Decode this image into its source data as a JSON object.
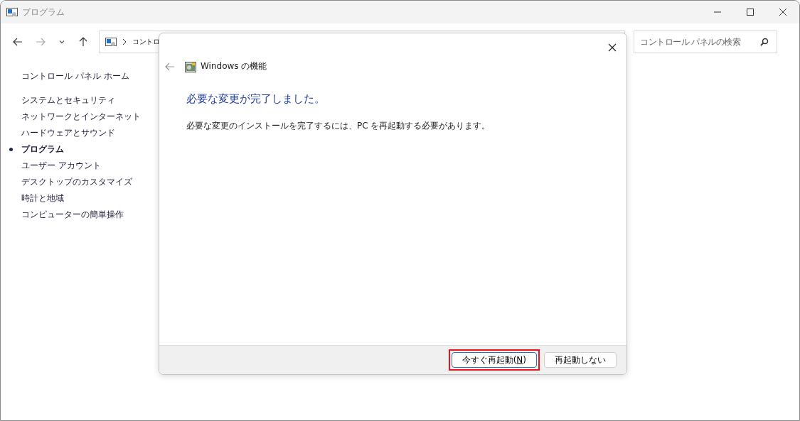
{
  "window": {
    "title": "プログラム"
  },
  "address_bar": {
    "crumb": "コントロ"
  },
  "search": {
    "placeholder": "コントロール パネルの検索"
  },
  "sidebar": {
    "home": "コントロール パネル ホーム",
    "items": [
      {
        "label": "システムとセキュリティ",
        "selected": false
      },
      {
        "label": "ネットワークとインターネット",
        "selected": false
      },
      {
        "label": "ハードウェアとサウンド",
        "selected": false
      },
      {
        "label": "プログラム",
        "selected": true
      },
      {
        "label": "ユーザー アカウント",
        "selected": false
      },
      {
        "label": "デスクトップのカスタマイズ",
        "selected": false
      },
      {
        "label": "時計と地域",
        "selected": false
      },
      {
        "label": "コンピューターの簡単操作",
        "selected": false
      }
    ]
  },
  "dialog": {
    "title": "Windows の機能",
    "heading": "必要な変更が完了しました。",
    "message": "必要な変更のインストールを完了するには、PC を再起動する必要があります。",
    "buttons": [
      {
        "label_before": "今すぐ再起動(",
        "access_key": "N",
        "label_after": ")",
        "highlighted": true,
        "default": true
      },
      {
        "label_before": "再起動しない",
        "highlighted": false,
        "default": false
      }
    ]
  }
}
